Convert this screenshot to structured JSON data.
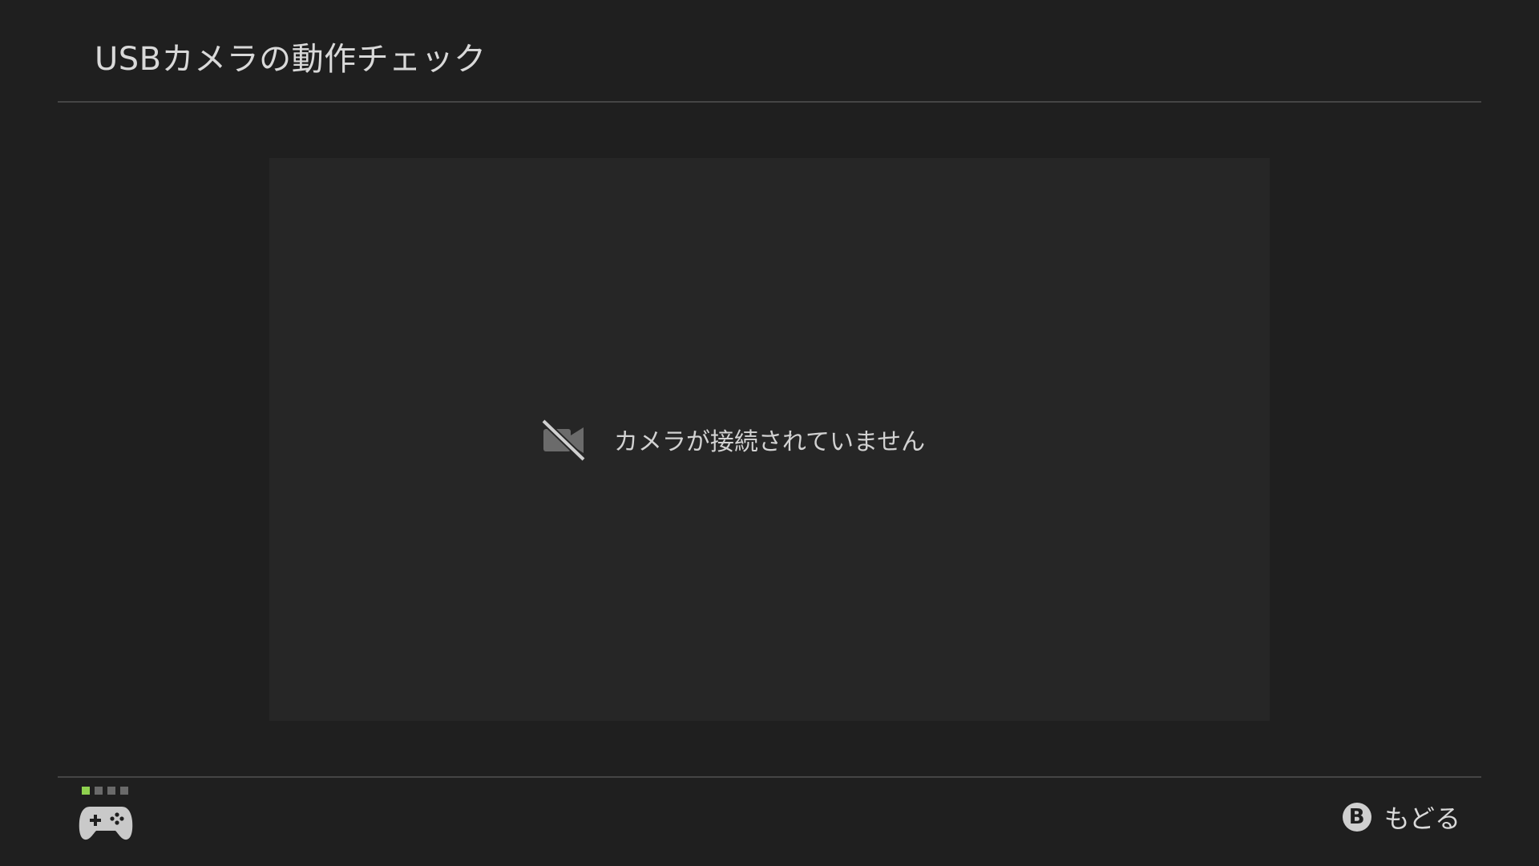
{
  "header": {
    "title": "USBカメラの動作チェック"
  },
  "preview": {
    "status_text": "カメラが接続されていません",
    "status_icon": "camera-off-icon"
  },
  "footer": {
    "player_indicator": {
      "active_player": 1,
      "total": 4,
      "active_color": "#8fd14f"
    },
    "controller_icon": "gamepad-icon",
    "back": {
      "button_glyph": "B",
      "label": "もどる"
    }
  },
  "colors": {
    "background": "#1f1f1f",
    "panel": "#262626",
    "divider": "#454545",
    "text": "#d9d9d9"
  }
}
